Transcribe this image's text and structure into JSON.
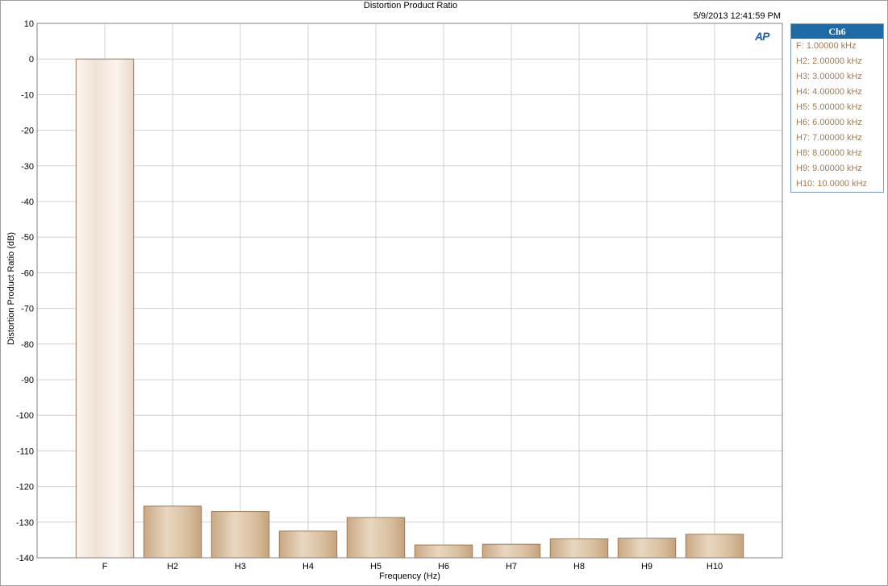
{
  "chart_data": {
    "type": "bar",
    "title": "Distortion Product Ratio",
    "timestamp": "5/9/2013 12:41:59 PM",
    "xlabel": "Frequency (Hz)",
    "ylabel": "Distortion Product Ratio (dB)",
    "ylim": [
      -140,
      10
    ],
    "yticks": [
      10,
      0,
      -10,
      -20,
      -30,
      -40,
      -50,
      -60,
      -70,
      -80,
      -90,
      -100,
      -110,
      -120,
      -130,
      -140
    ],
    "categories": [
      "F",
      "H2",
      "H3",
      "H4",
      "H5",
      "H6",
      "H7",
      "H8",
      "H9",
      "H10"
    ],
    "series": [
      {
        "name": "Ch6",
        "values": [
          0,
          -125.5,
          -127.0,
          -132.5,
          -128.7,
          -136.4,
          -136.2,
          -134.7,
          -134.5,
          -133.4
        ]
      }
    ],
    "grid": true,
    "legend_position": "right"
  },
  "logo": "AP",
  "legend": {
    "title": "Ch6",
    "items": [
      "F: 1.00000 kHz",
      "H2: 2.00000 kHz",
      "H3: 3.00000 kHz",
      "H4: 4.00000 kHz",
      "H5: 5.00000 kHz",
      "H6: 6.00000 kHz",
      "H7: 7.00000 kHz",
      "H8: 8.00000 kHz",
      "H9: 9.00000 kHz",
      "H10: 10.0000 kHz"
    ]
  },
  "colors": {
    "bar_fundamental": "#f3e7da",
    "bar_harmonic": "#d7bb99",
    "bar_edge": "#a07c52",
    "legend_text": "#a07c52",
    "legend_header": "#1e6aa6",
    "grid": "#d0d0d0"
  }
}
